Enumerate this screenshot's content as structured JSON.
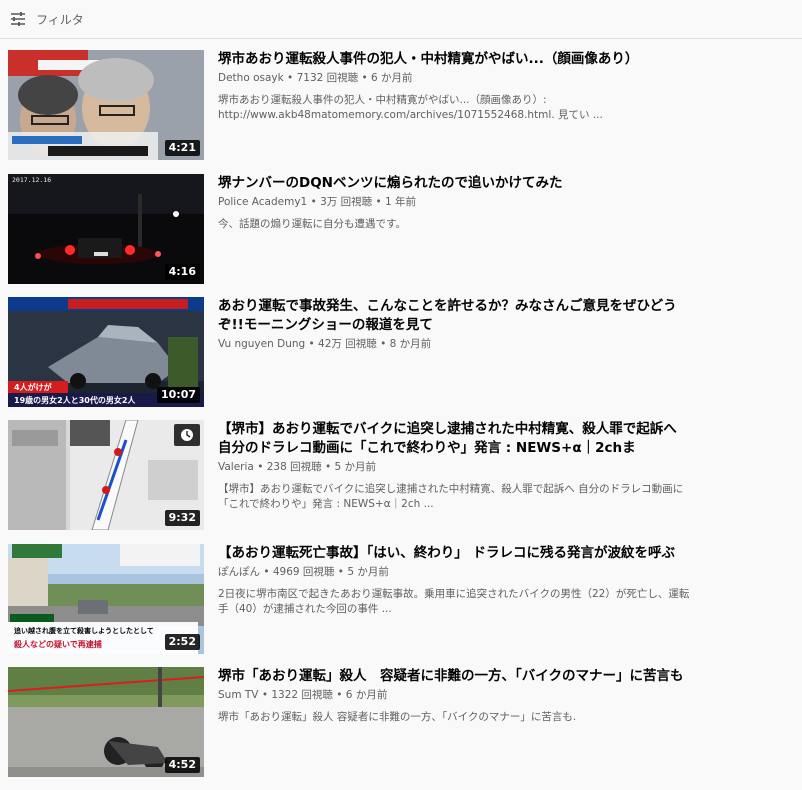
{
  "filter": {
    "label": "フィルタ",
    "icon": "filter-sliders-icon"
  },
  "videos": [
    {
      "title": "堺市あおり運転殺人事件の犯人・中村精寛がやばい...（顔画像あり）",
      "channel": "Detho osayk",
      "views": "7132 回視聴",
      "age": "6 か月前",
      "description": "堺市あおり運転殺人事件の犯人・中村精寛がやばい...（顔画像あり）: http://www.akb48matomemory.com/archives/1071552468.html. 見てい ...",
      "duration": "4:21"
    },
    {
      "title": "堺ナンバーのDQNベンツに煽られたので追いかけてみた",
      "channel": "Police Academy1",
      "views": "3万 回視聴",
      "age": "1 年前",
      "description": "今、話題の煽り運転に自分も遭遇です。",
      "duration": "4:16",
      "thumb_date": "2017.12.16"
    },
    {
      "title": "あおり運転で事故発生、こんなことを許せるか？みなさんご意見をぜひどうぞ!!モーニングショーの報道を見て",
      "channel": "Vu nguyen Dung",
      "views": "42万 回視聴",
      "age": "8 か月前",
      "description": "",
      "duration": "10:07",
      "thumb_caption_1": "4人がけが",
      "thumb_caption_2": "19歳の男女2人と30代の男女2人"
    },
    {
      "title": "【堺市】あおり運転でバイクに追突し逮捕された中村精寛、殺人罪で起訴へ　自分のドラレコ動画に「これで終わりや」発言 : NEWS+α｜2chま",
      "channel": "Valeria",
      "views": "238 回視聴",
      "age": "5 か月前",
      "description": "【堺市】あおり運転でバイクに追突し逮捕された中村精寛、殺人罪で起訴へ 自分のドラレコ動画に「これで終わりや」発言 : NEWS+α｜2ch ...",
      "duration": "9:32"
    },
    {
      "title": "【あおり運転死亡事故】「はい、終わり」 ドラレコに残る発言が波紋を呼ぶ",
      "channel": "ぽんぽん",
      "views": "4969 回視聴",
      "age": "5 か月前",
      "description": "2日夜に堺市南区で起きたあおり運転事故。乗用車に追突されたバイクの男性（22）が死亡し、運転手（40）が逮捕された今回の事件 ...",
      "duration": "2:52",
      "thumb_caption_1": "追い越され腹を立て殺害しようとしたとして",
      "thumb_caption_2": "殺人などの疑いで再逮捕"
    },
    {
      "title": "堺市「あおり運転」殺人　容疑者に非難の一方、「バイクのマナー」に苦言も",
      "channel": "Sum TV",
      "views": "1322 回視聴",
      "age": "6 か月前",
      "description": "堺市「あおり運転」殺人 容疑者に非難の一方、「バイクのマナー」に苦言も.",
      "duration": "4:52"
    }
  ]
}
